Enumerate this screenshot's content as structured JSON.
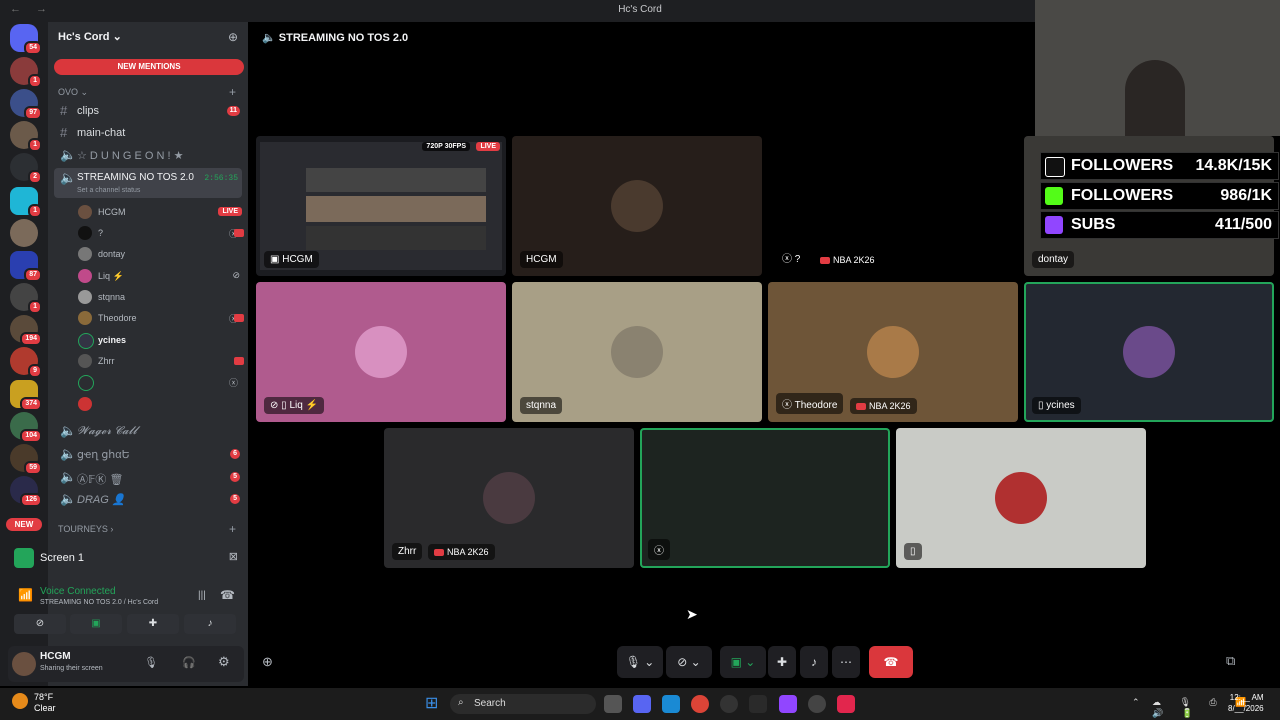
{
  "window": {
    "title": "Hc's Cord"
  },
  "server": {
    "name": "Hc's Cord",
    "new_mentions": "NEW MENTIONS",
    "new_badge": "NEW"
  },
  "rail_badges": [
    "54",
    "1",
    "97",
    "1",
    "2",
    "1",
    "87",
    "1",
    "194",
    "9",
    "374",
    "104",
    "59",
    "126"
  ],
  "sidebar": {
    "category_ovo": "OVO",
    "channels": [
      {
        "name": "clips",
        "type": "text",
        "count": "11"
      },
      {
        "name": "main-chat",
        "type": "text",
        "count": ""
      },
      {
        "name": "☆ D U N G E O N ! ★",
        "type": "voice",
        "count": ""
      },
      {
        "name": "STREAMING NO TOS 2.0",
        "type": "voice",
        "count": "",
        "time": "2:56:35",
        "status": "Set a channel status"
      }
    ],
    "voice_users": [
      {
        "name": "HCGM",
        "live": "LIVE"
      },
      {
        "name": "?"
      },
      {
        "name": "dontay"
      },
      {
        "name": "Liq ⚡"
      },
      {
        "name": "stqnna"
      },
      {
        "name": "Theodore"
      },
      {
        "name": "ycines"
      },
      {
        "name": "Zhrr"
      },
      {
        "name": ""
      },
      {
        "name": ""
      }
    ],
    "more_channels": [
      {
        "name": "𝓦𝓪𝓰𝓮𝓻 𝓒𝓪𝓵𝓵",
        "count": ""
      },
      {
        "name": "ցҽղ ցհαԵ",
        "count": "6"
      },
      {
        "name": "Ⓐ𝔽Ⓚ 🗑",
        "count": "5"
      },
      {
        "name": "DRAG 👤",
        "count": "5"
      }
    ],
    "category_tourneys": "TOURNEYS"
  },
  "screen_row": {
    "label": "Screen 1"
  },
  "voice_panel": {
    "status": "Voice Connected",
    "channel": "STREAMING NO TOS 2.0 / Hc's Cord"
  },
  "user_panel": {
    "name": "HCGM",
    "status": "Sharing their screen"
  },
  "stage": {
    "title": "STREAMING NO TOS 2.0",
    "stream_quality": "720P 30FPS",
    "live": "LIVE",
    "tiles": [
      {
        "name": "HCGM",
        "game": ""
      },
      {
        "name": "HCGM",
        "game": ""
      },
      {
        "name": "?",
        "game": "NBA 2K26"
      },
      {
        "name": "dontay",
        "game": ""
      },
      {
        "name": "Liq ⚡",
        "game": ""
      },
      {
        "name": "stqnna",
        "game": ""
      },
      {
        "name": "Theodore",
        "game": "NBA 2K26"
      },
      {
        "name": "ycines",
        "game": ""
      },
      {
        "name": "Zhrr",
        "game": "NBA 2K26"
      },
      {
        "name": "",
        "game": ""
      },
      {
        "name": "",
        "game": ""
      }
    ]
  },
  "overlay": [
    {
      "label": "FOLLOWERS",
      "value": "14.8K/15K",
      "color": "#ffffff"
    },
    {
      "label": "FOLLOWERS",
      "value": "986/1K",
      "color": "#53fc18"
    },
    {
      "label": "SUBS",
      "value": "411/500",
      "color": "#9146ff"
    }
  ],
  "taskbar": {
    "temp": "78°F",
    "condition": "Clear",
    "search": "Search",
    "time": "12:__ AM",
    "date": "8/__/2026"
  },
  "colors": {
    "accent_red": "#da373c",
    "live_red": "#e23c43",
    "connected_green": "#23a55a"
  }
}
